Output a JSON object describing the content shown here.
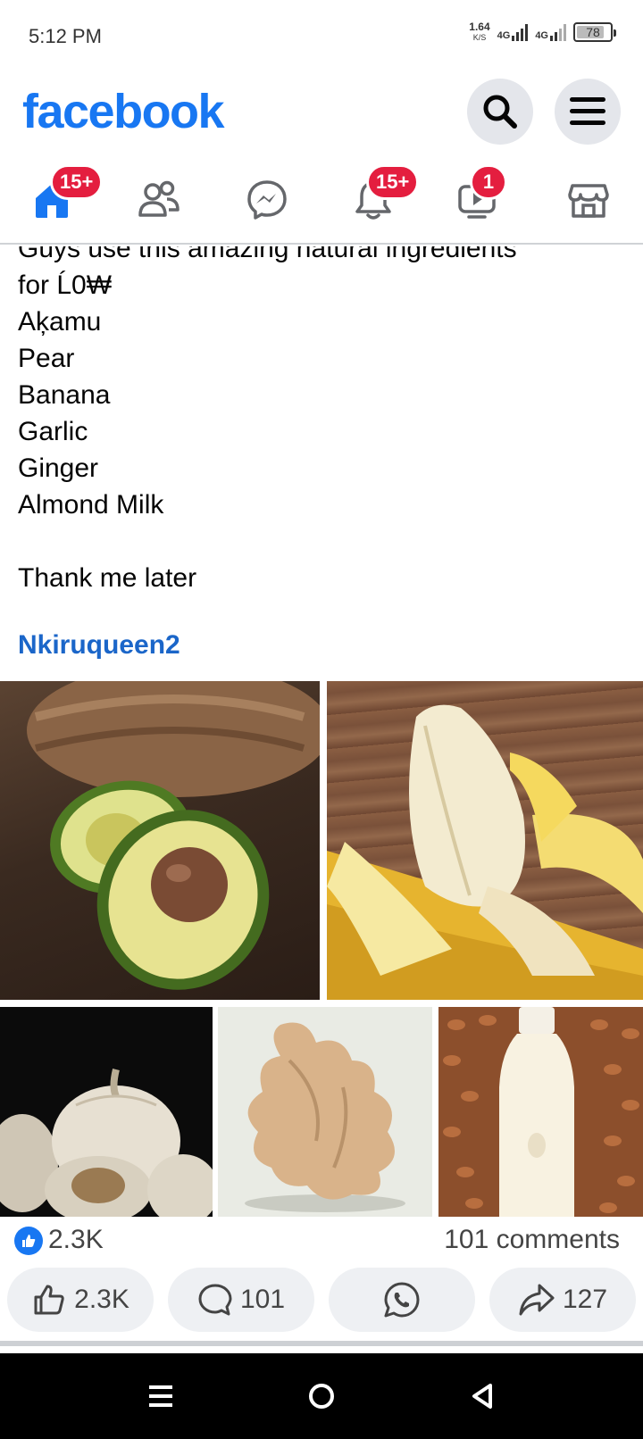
{
  "status_bar": {
    "time": "5:12 PM",
    "speed_value": "1.64",
    "speed_unit": "K/S",
    "network_1": "4G",
    "network_2": "4G",
    "battery": "78"
  },
  "header": {
    "logo": "facebook",
    "search_icon": "search-icon",
    "menu_icon": "hamburger-menu-icon"
  },
  "nav_tabs": [
    {
      "name": "home",
      "icon": "home-icon",
      "badge": "15+",
      "active": true
    },
    {
      "name": "friends",
      "icon": "friends-icon",
      "badge": ""
    },
    {
      "name": "messenger",
      "icon": "messenger-icon",
      "badge": ""
    },
    {
      "name": "notifications",
      "icon": "bell-icon",
      "badge": "15+"
    },
    {
      "name": "video",
      "icon": "video-icon",
      "badge": "1"
    },
    {
      "name": "marketplace",
      "icon": "store-icon",
      "badge": ""
    }
  ],
  "post": {
    "lines": [
      "Guys use this amazing natural ingredients",
      "for Ĺ0₩",
      "Aķamu",
      "Pear",
      "Banana",
      "Garlic",
      "Ginger",
      "Almond Milk",
      "",
      "Thank me later"
    ],
    "hashtag": "Nkiruqueen2"
  },
  "photos": [
    {
      "subject": "avocado"
    },
    {
      "subject": "banana"
    },
    {
      "subject": "garlic"
    },
    {
      "subject": "ginger"
    },
    {
      "subject": "almond milk"
    }
  ],
  "stats": {
    "likes": "2.3K",
    "comments": "101 comments"
  },
  "actions": {
    "like": "2.3K",
    "comment": "101",
    "whatsapp_icon": "whatsapp-icon",
    "share": "127"
  },
  "colors": {
    "brand": "#1877f2",
    "badge": "#e41e3f",
    "hashtag": "#1b66c9"
  }
}
